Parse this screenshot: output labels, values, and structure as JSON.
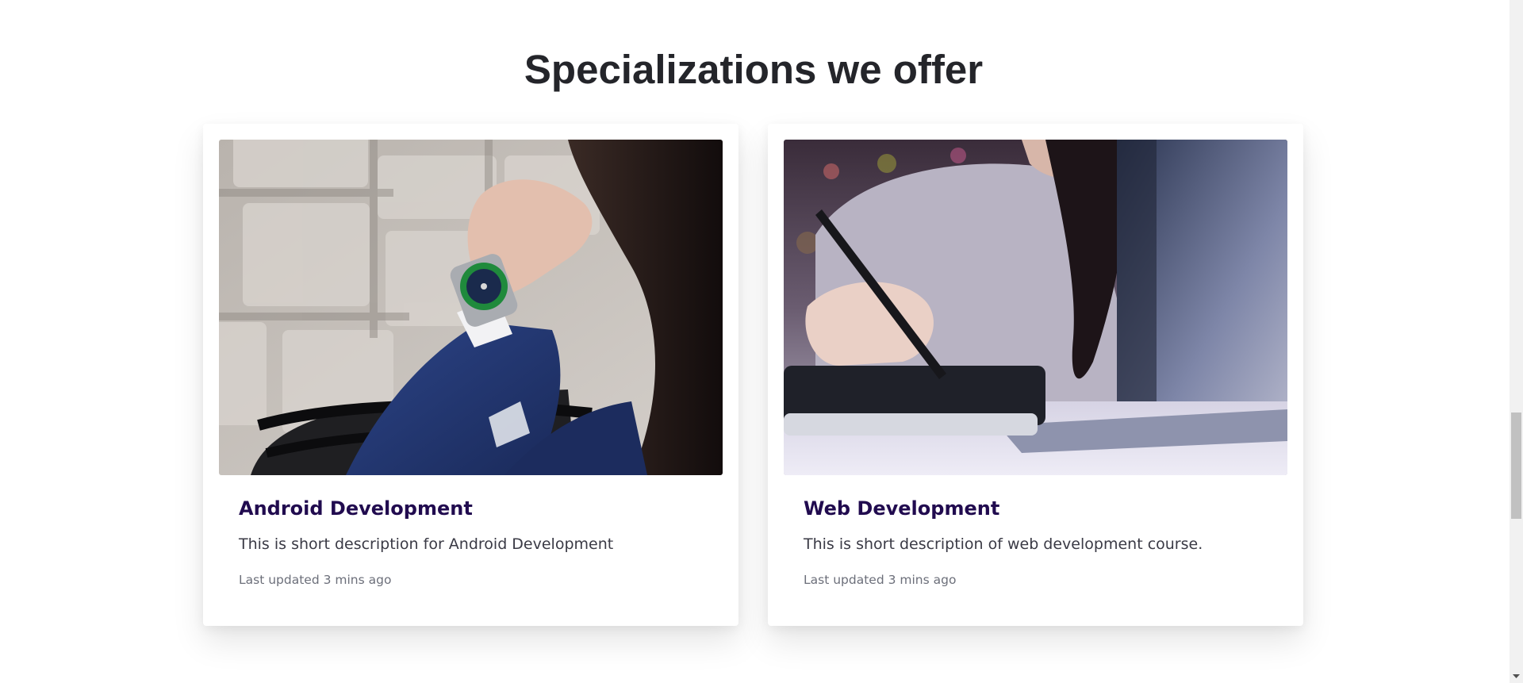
{
  "section": {
    "title": "Specializations we offer"
  },
  "cards": [
    {
      "title": "Android Development",
      "description": "This is short description for Android Development",
      "meta": "Last updated 3 mins ago",
      "image_icon": "wristwatch-photo"
    },
    {
      "title": "Web Development",
      "description": "This is short description of web development course.",
      "meta": "Last updated 3 mins ago",
      "image_icon": "laptop-drawing-tablet-photo"
    }
  ],
  "colors": {
    "heading": "#24252a",
    "card_title": "#210b4f",
    "body_text": "#3a3a45",
    "muted_text": "#6c6f7a"
  }
}
